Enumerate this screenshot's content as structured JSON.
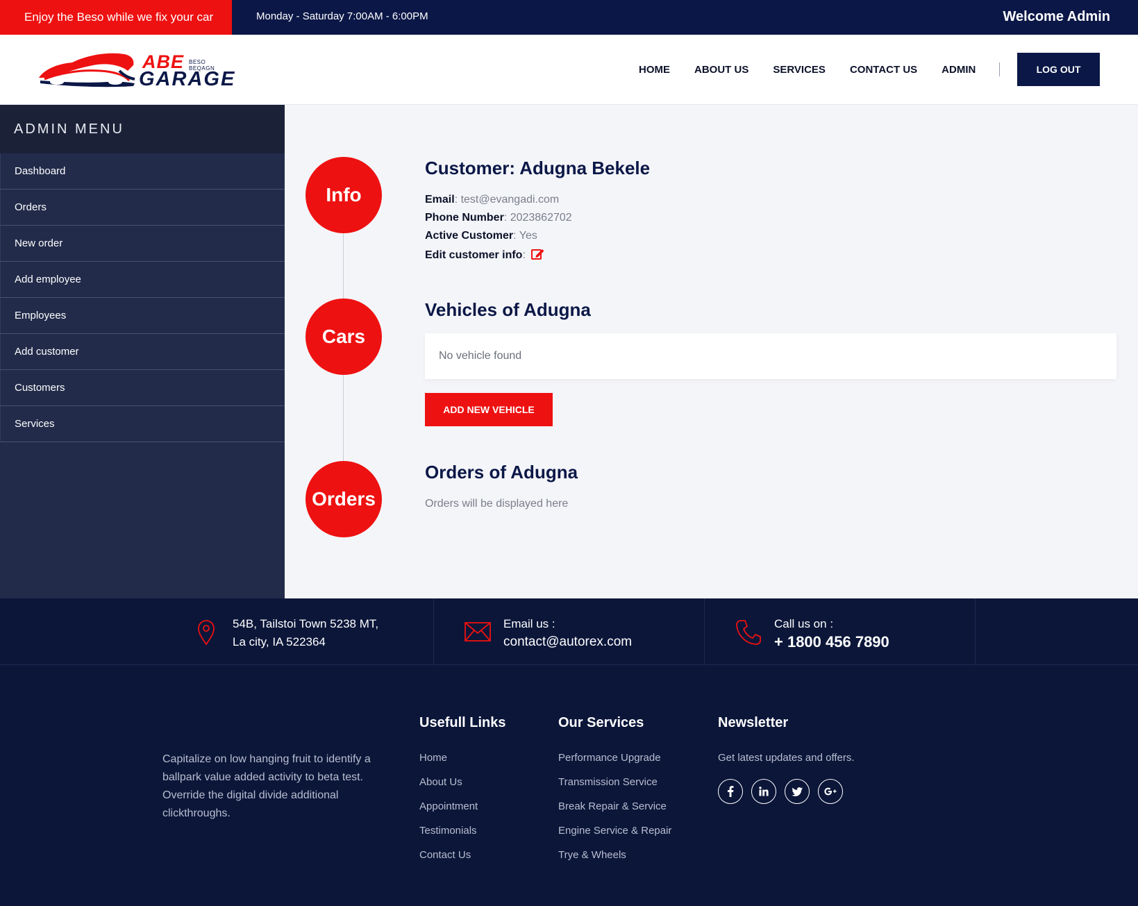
{
  "topbar": {
    "promo": "Enjoy the Beso while we fix your car",
    "hours": "Monday - Saturday 7:00AM - 6:00PM",
    "welcome": "Welcome Admin"
  },
  "logo": {
    "abe": "ABE",
    "tagline": "BESO BEQAGN",
    "garage": "GARAGE"
  },
  "nav": {
    "items": [
      "HOME",
      "ABOUT US",
      "SERVICES",
      "CONTACT US",
      "ADMIN"
    ],
    "logout": "LOG OUT"
  },
  "sidebar": {
    "title": "ADMIN MENU",
    "items": [
      "Dashboard",
      "Orders",
      "New order",
      "Add employee",
      "Employees",
      "Add customer",
      "Customers",
      "Services"
    ]
  },
  "customer": {
    "circle": "Info",
    "title": "Customer: Adugna Bekele",
    "email_label": "Email",
    "email": "test@evangadi.com",
    "phone_label": "Phone Number",
    "phone": "2023862702",
    "active_label": "Active Customer",
    "active": "Yes",
    "edit_label": "Edit customer info"
  },
  "vehicles": {
    "circle": "Cars",
    "title": "Vehicles of Adugna",
    "empty": "No vehicle found",
    "add_button": "ADD NEW VEHICLE"
  },
  "orders": {
    "circle": "Orders",
    "title": "Orders of Adugna",
    "text": "Orders will be displayed here"
  },
  "contact": {
    "address_line1": "54B, Tailstoi Town 5238 MT,",
    "address_line2": "La city, IA 522364",
    "email_label": "Email us :",
    "email": "contact@autorex.com",
    "phone_label": "Call us on :",
    "phone": "+ 1800 456 7890"
  },
  "footer": {
    "about": "Capitalize on low hanging fruit to identify a ballpark value added activity to beta test. Override the digital divide additional clickthroughs.",
    "links_title": "Usefull Links",
    "links": [
      "Home",
      "About Us",
      "Appointment",
      "Testimonials",
      "Contact Us"
    ],
    "services_title": "Our Services",
    "services": [
      "Performance Upgrade",
      "Transmission Service",
      "Break Repair & Service",
      "Engine Service & Repair",
      "Trye & Wheels"
    ],
    "newsletter_title": "Newsletter",
    "newsletter_text": "Get latest updates and offers.",
    "socials": [
      "facebook-icon",
      "linkedin-icon",
      "twitter-icon",
      "google-plus-icon"
    ]
  },
  "colors": {
    "brand_red": "#ee1111",
    "brand_navy": "#0b1847",
    "sidebar": "#222b4a"
  }
}
